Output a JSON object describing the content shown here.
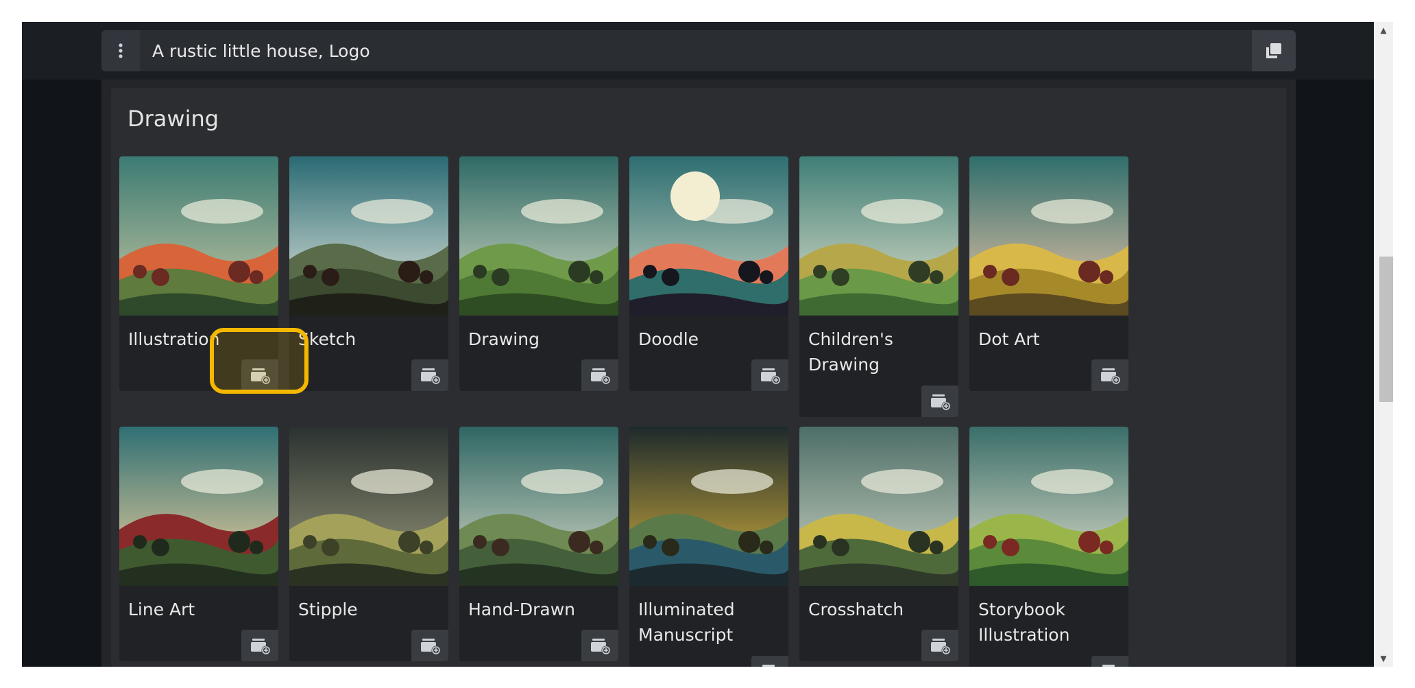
{
  "prompt": {
    "value": "A rustic little house, Logo",
    "menu_icon": "vertical-dots-icon",
    "copy_icon": "copy-icon"
  },
  "section": {
    "title": "Drawing",
    "cards": [
      {
        "label": "Illustration",
        "theme": "illustration"
      },
      {
        "label": "Sketch",
        "theme": "sketch"
      },
      {
        "label": "Drawing",
        "theme": "drawing"
      },
      {
        "label": "Doodle",
        "theme": "doodle"
      },
      {
        "label": "Children's Drawing",
        "theme": "children"
      },
      {
        "label": "Dot Art",
        "theme": "dotart"
      },
      {
        "label": "Line Art",
        "theme": "lineart"
      },
      {
        "label": "Stipple",
        "theme": "stipple"
      },
      {
        "label": "Hand-Drawn",
        "theme": "handdrawn"
      },
      {
        "label": "Illuminated Manuscript",
        "theme": "illuminated"
      },
      {
        "label": "Crosshatch",
        "theme": "crosshatch"
      },
      {
        "label": "Storybook Illustration",
        "theme": "storybook"
      }
    ],
    "add_button_icon": "add-to-collection-icon"
  },
  "colors": {
    "highlight": "#f5b800",
    "background": "#15181c",
    "card": "#202226",
    "text": "#e8e8e8"
  }
}
